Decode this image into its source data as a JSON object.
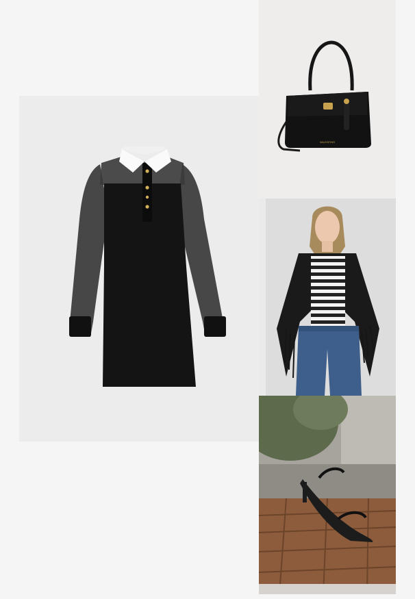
{
  "page": {
    "background": "#f5f5f5"
  },
  "products": [
    {
      "id": "dress",
      "kind": "black-shirt-dress-with-white-collar",
      "icon": "dress-image"
    },
    {
      "id": "bag",
      "kind": "black-leather-handbag",
      "icon": "handbag-image",
      "logo_text": "VALENTINO"
    },
    {
      "id": "model",
      "kind": "striped-top-fringed-shawl-jeans",
      "icon": "model-photo"
    },
    {
      "id": "sandal",
      "kind": "black-strappy-sandal",
      "icon": "sandal-image"
    }
  ]
}
